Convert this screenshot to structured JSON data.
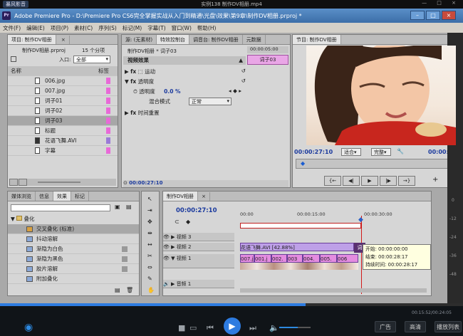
{
  "player": {
    "brand": "暴风影音",
    "file_title": "实例138 制作DV相册.mp4",
    "window_controls": "— □ ×",
    "time_readout": "00:15:52/00:24:05",
    "progress": 0.66,
    "chip_logo": "广告",
    "chip_quality": "高清",
    "chip_list": "播放列表"
  },
  "app": {
    "title": "Adobe Premiere Pro - D:\\Premiere Pro CS6完全掌握实战从入门到精通\\光盘\\效果\\第9章\\制作DV相册.prproj *",
    "menu": [
      "文件(F)",
      "编辑(E)",
      "项目(P)",
      "素材(C)",
      "序列(S)",
      "标记(M)",
      "字幕(T)",
      "窗口(W)",
      "帮助(H)"
    ]
  },
  "project": {
    "tab": "项目: 制作DV相册",
    "tab_close": "×",
    "file": "制作DV相册.prproj",
    "count": "15 个分项",
    "in_label": "入口:",
    "in_value": "全部",
    "col_name": "名称",
    "col_label": "标签",
    "items": [
      "006.jpg",
      "007.jpg",
      "词子01",
      "词子02",
      "词子03",
      "标题",
      "花语飞舞.AVI",
      "字幕"
    ]
  },
  "effects_panel": {
    "tabs": [
      "媒体浏览",
      "信息",
      "效果",
      "标记"
    ],
    "folder": "叠化",
    "items": [
      "交叉叠化 (标准)",
      "抖动溶解",
      "渐隐为白色",
      "渐隐为黑色",
      "胶片溶解",
      "附加叠化"
    ]
  },
  "effect_controls": {
    "tabs": [
      "源: (无素材)",
      "特效控制台",
      "调音台: 制作DV相册",
      "元数据"
    ],
    "clip": "制作DV相册 * 词子03",
    "ruler_time": "00:00:05:00",
    "clip_chip": "词子03",
    "section": "视频效果",
    "motion": "运动",
    "opacity": "透明度",
    "opacity_prop": "透明度",
    "opacity_value": "0.0 %",
    "blend_label": "混合模式",
    "blend_value": "正常",
    "time_remap": "时间重置",
    "bottom_tc": "00:00:27:10"
  },
  "program": {
    "tab": "节目: 制作DV相册",
    "timecode": "00:00:27:10",
    "end_tc": "00:00:28:",
    "fit": "适合",
    "res": "完整"
  },
  "timeline": {
    "tab": "制作DV相册",
    "tab_close": "×",
    "timecode": "00:00:27:10",
    "ruler": [
      "00:00",
      "00:00:15:00",
      "00:00:30:00"
    ],
    "tracks": [
      "视频 3",
      "视频 2",
      "视频 1",
      "音频 1"
    ],
    "clip_v2": "花语飞舞.AVI [42.88%]",
    "clips_v1": [
      "007.ji",
      "001.j",
      "002.",
      "003",
      "004.",
      "005.",
      "006"
    ],
    "tooltip_label": "词",
    "tooltip": [
      "开始: 00:00:00:00",
      "结束: 00:00:28:17",
      "持续时间: 00:00:28:17"
    ],
    "db_scale": [
      "0",
      "-12",
      "-24",
      "-36",
      "-48"
    ]
  }
}
